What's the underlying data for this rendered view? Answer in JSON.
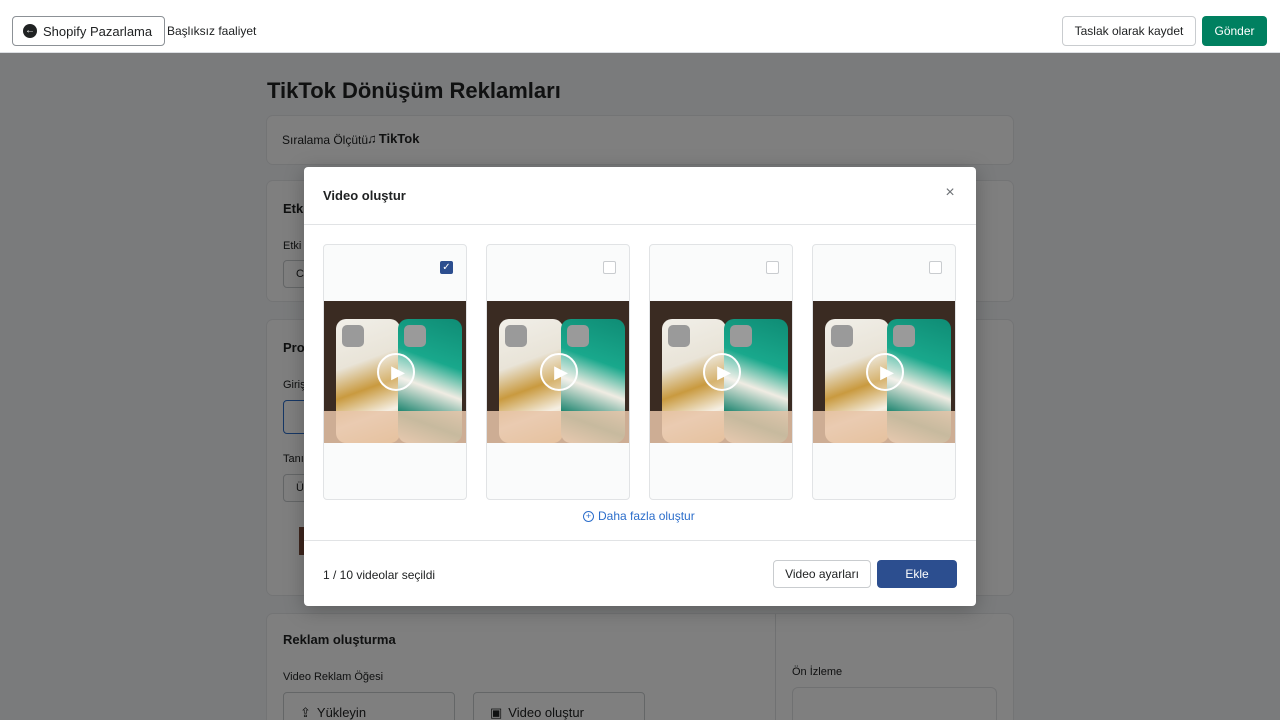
{
  "topbar": {
    "back_label": "Shopify Pazarlama",
    "breadcrumb": "Başlıksız faaliyet",
    "draft_label": "Taslak olarak kaydet",
    "send_label": "Gönder"
  },
  "page": {
    "title": "TikTok Dönüşüm Reklamları",
    "sort_label": "Sıralama Ölçütü",
    "tiktok_label": "TikTok",
    "card2": {
      "heading": "Etki",
      "sub": "Etki",
      "input": "C"
    },
    "card3": {
      "heading": "Pro",
      "sub1": "Giriş",
      "sub2": "Tanı",
      "input": "Ü"
    },
    "card4": {
      "heading": "Reklam oluşturma",
      "sub": "Video Reklam Öğesi",
      "upload_label": "Yükleyin",
      "create_label": "Video oluştur",
      "preview_label": "Ön İzleme"
    }
  },
  "modal": {
    "title": "Video oluştur",
    "close_glyph": "×",
    "videos": [
      {
        "checked": true
      },
      {
        "checked": false
      },
      {
        "checked": false
      },
      {
        "checked": false
      }
    ],
    "more_label": "Daha fazla oluştur",
    "selected_count": "1 / 10 videolar seçildi",
    "settings_label": "Video ayarları",
    "add_label": "Ekle"
  },
  "colors": {
    "primary_green": "#008060",
    "modal_blue": "#2c4e8f",
    "link_blue": "#2c6ecb"
  }
}
